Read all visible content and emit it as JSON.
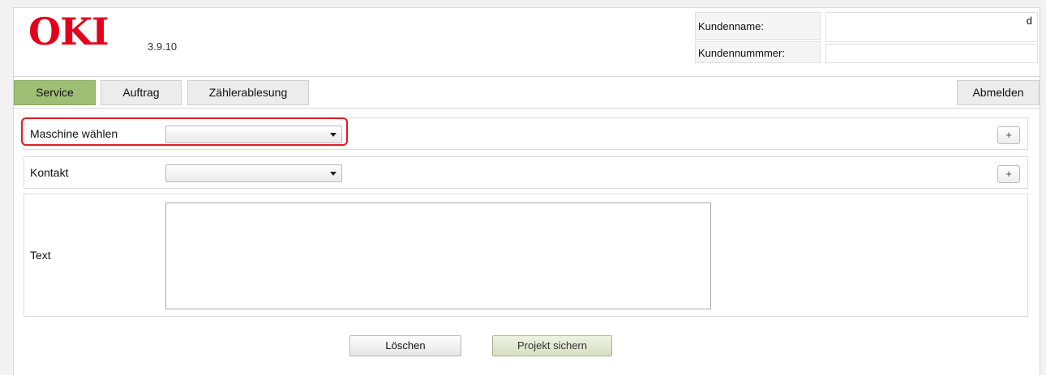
{
  "header": {
    "logo_text": "OKI",
    "logo_color": "#e3001b",
    "version": "3.9.10",
    "customer_name_label": "Kundenname:",
    "customer_name_value": "d",
    "customer_number_label": "Kundennummmer:",
    "customer_number_value": ""
  },
  "tabs": [
    {
      "label": "Service",
      "active": true
    },
    {
      "label": "Auftrag",
      "active": false
    },
    {
      "label": "Zählerablesung",
      "active": false
    }
  ],
  "logout_label": "Abmelden",
  "form": {
    "machine_label": "Maschine wählen",
    "machine_selected": "",
    "contact_label": "Kontakt",
    "contact_selected": "",
    "plus_label": "+",
    "text_label": "Text",
    "text_value": ""
  },
  "buttons": {
    "delete_label": "Löschen",
    "save_label": "Projekt sichern"
  },
  "colors": {
    "active_tab": "#9fbf76",
    "highlight": "#e01c24"
  }
}
